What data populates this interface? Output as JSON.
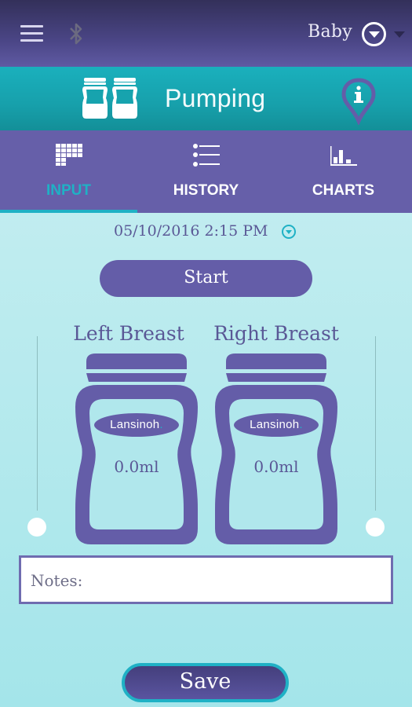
{
  "topbar": {
    "menu_icon": "hamburger-menu-icon",
    "bluetooth_icon": "bluetooth-icon",
    "baby_selector": {
      "label": "Baby",
      "icon": "chevron-down-circle-icon"
    }
  },
  "titlebar": {
    "title": "Pumping",
    "title_icon": "breast-milk-bottles-icon",
    "info_icon": "info-pin-icon"
  },
  "tabs": [
    {
      "label": "INPUT",
      "icon": "keypad-grid-icon",
      "active": true
    },
    {
      "label": "HISTORY",
      "icon": "list-icon",
      "active": false
    },
    {
      "label": "CHARTS",
      "icon": "bar-chart-icon",
      "active": false
    }
  ],
  "session": {
    "datetime": "05/10/2016 2:15 PM",
    "start_label": "Start"
  },
  "breasts": {
    "left": {
      "label": "Left Breast",
      "brand": "Lansinoh",
      "amount": "0.0ml",
      "level": 0
    },
    "right": {
      "label": "Right Breast",
      "brand": "Lansinoh",
      "amount": "0.0ml",
      "level": 0
    }
  },
  "notes": {
    "placeholder": "Notes:",
    "value": ""
  },
  "save_label": "Save",
  "colors": {
    "purple": "#645da8",
    "teal": "#1fb1c5",
    "header_dark": "#33305a"
  }
}
